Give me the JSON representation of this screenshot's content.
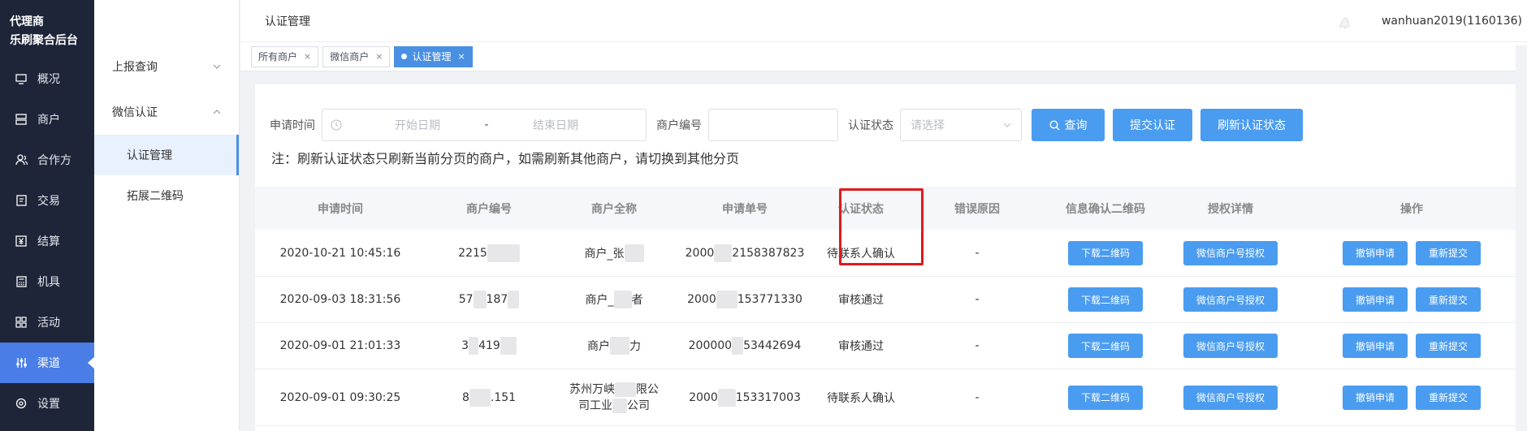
{
  "nav": {
    "brand": [
      "代理商",
      "乐刷聚合后台"
    ],
    "items": [
      {
        "label": "概况",
        "icon": "monitor-icon"
      },
      {
        "label": "商户",
        "icon": "server-icon"
      },
      {
        "label": "合作方",
        "icon": "users-icon"
      },
      {
        "label": "交易",
        "icon": "document-icon"
      },
      {
        "label": "结算",
        "icon": "yuan-icon"
      },
      {
        "label": "机具",
        "icon": "calculator-icon"
      },
      {
        "label": "活动",
        "icon": "grid-icon"
      },
      {
        "label": "渠道",
        "icon": "sliders-icon"
      },
      {
        "label": "设置",
        "icon": "gear-icon"
      }
    ],
    "active_index": 7
  },
  "submenu": {
    "groups": [
      {
        "label": "上报查询",
        "expanded": false
      },
      {
        "label": "微信认证",
        "expanded": true
      }
    ],
    "items": [
      "认证管理",
      "拓展二维码"
    ],
    "active_item": "认证管理"
  },
  "topbar": {
    "title": "认证管理",
    "user": "wanhuan2019(1160136)"
  },
  "tabs": [
    {
      "label": "所有商户",
      "active": false
    },
    {
      "label": "微信商户",
      "active": false
    },
    {
      "label": "认证管理",
      "active": true
    }
  ],
  "filters": {
    "apply_time_label": "申请时间",
    "start_placeholder": "开始日期",
    "date_sep": "-",
    "end_placeholder": "结束日期",
    "merchant_no_label": "商户编号",
    "auth_status_label": "认证状态",
    "auth_status_placeholder": "请选择",
    "query_button": "查询",
    "submit_button": "提交认证",
    "refresh_button": "刷新认证状态"
  },
  "note": "注：刷新认证状态只刷新当前分页的商户，如需刷新其他商户，请切换到其他分页",
  "table": {
    "columns": [
      "申请时间",
      "商户编号",
      "商户全称",
      "申请单号",
      "认证状态",
      "错误原因",
      "信息确认二维码",
      "授权详情",
      "操作"
    ],
    "rows": [
      {
        "time": "2020-10-21 10:45:16",
        "merchant_no": [
          "2215",
          ""
        ],
        "name": [
          "商户_张",
          ""
        ],
        "apply_no": [
          "2000",
          "2158387823"
        ],
        "status": "待联系人确认",
        "error": "-"
      },
      {
        "time": "2020-09-03 18:31:56",
        "merchant_no": [
          "57",
          "187"
        ],
        "name": [
          "商户_",
          "者"
        ],
        "apply_no": [
          "2000",
          "153771330"
        ],
        "status": "审核通过",
        "error": "-"
      },
      {
        "time": "2020-09-01 21:01:33",
        "merchant_no": [
          "3",
          "419"
        ],
        "name": [
          "商户",
          "力"
        ],
        "apply_no": [
          "200000",
          "53442694"
        ],
        "status": "审核通过",
        "error": "-"
      },
      {
        "time": "2020-09-01 09:30:25",
        "merchant_no": [
          "8",
          ".151"
        ],
        "name": [
          "苏州万峡",
          "限公",
          "司工业",
          "公司"
        ],
        "apply_no": [
          "2000",
          "153317003"
        ],
        "status": "待联系人确认",
        "error": "-"
      }
    ],
    "download_qr": "下载二维码",
    "wechat_auth": "微信商户号授权",
    "cancel_apply": "撤销申请",
    "resubmit": "重新提交"
  },
  "colors": {
    "sidebar_bg": "#1e2538",
    "active_nav": "#4a7ee6",
    "primary_button": "#4a9cf0",
    "highlight_box": "#e0191b"
  }
}
